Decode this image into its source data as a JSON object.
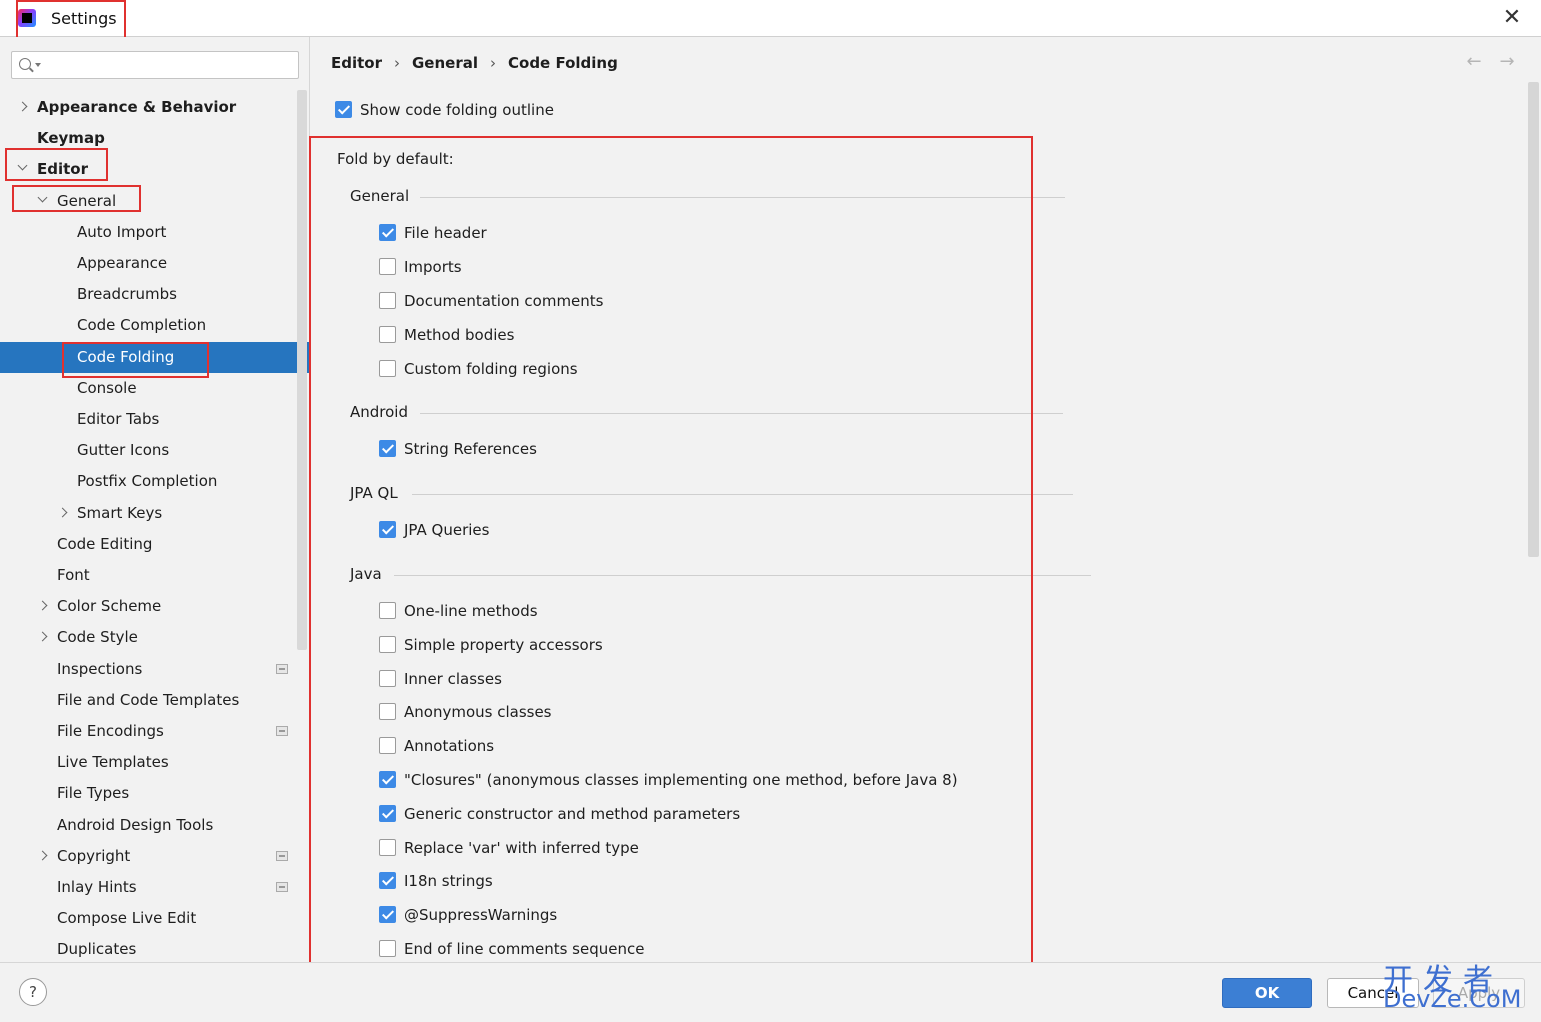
{
  "window": {
    "title": "Settings",
    "close_glyph": "✕",
    "help_glyph": "?"
  },
  "search": {
    "placeholder": ""
  },
  "breadcrumb": [
    "Editor",
    "General",
    "Code Folding"
  ],
  "breadcrumb_sep": "›",
  "nav": {
    "back": "←",
    "forward": "→"
  },
  "tree": [
    {
      "label": "Appearance & Behavior",
      "bold": true,
      "chevron": "right"
    },
    {
      "label": "Keymap",
      "bold": true,
      "chevron": ""
    },
    {
      "label": "Editor",
      "bold": true,
      "chevron": "down"
    },
    {
      "label": "General",
      "bold": false,
      "chevron": "down"
    },
    {
      "label": "Auto Import",
      "bold": false,
      "chevron": ""
    },
    {
      "label": "Appearance",
      "bold": false,
      "chevron": ""
    },
    {
      "label": "Breadcrumbs",
      "bold": false,
      "chevron": ""
    },
    {
      "label": "Code Completion",
      "bold": false,
      "chevron": ""
    },
    {
      "label": "Code Folding",
      "bold": false,
      "chevron": "",
      "selected": true
    },
    {
      "label": "Console",
      "bold": false,
      "chevron": ""
    },
    {
      "label": "Editor Tabs",
      "bold": false,
      "chevron": ""
    },
    {
      "label": "Gutter Icons",
      "bold": false,
      "chevron": ""
    },
    {
      "label": "Postfix Completion",
      "bold": false,
      "chevron": ""
    },
    {
      "label": "Smart Keys",
      "bold": false,
      "chevron": "right"
    },
    {
      "label": "Code Editing",
      "bold": false,
      "chevron": ""
    },
    {
      "label": "Font",
      "bold": false,
      "chevron": ""
    },
    {
      "label": "Color Scheme",
      "bold": false,
      "chevron": "right"
    },
    {
      "label": "Code Style",
      "bold": false,
      "chevron": "right"
    },
    {
      "label": "Inspections",
      "bold": false,
      "chevron": "",
      "project_icon": true
    },
    {
      "label": "File and Code Templates",
      "bold": false,
      "chevron": ""
    },
    {
      "label": "File Encodings",
      "bold": false,
      "chevron": "",
      "project_icon": true
    },
    {
      "label": "Live Templates",
      "bold": false,
      "chevron": ""
    },
    {
      "label": "File Types",
      "bold": false,
      "chevron": ""
    },
    {
      "label": "Android Design Tools",
      "bold": false,
      "chevron": ""
    },
    {
      "label": "Copyright",
      "bold": false,
      "chevron": "right",
      "project_icon": true
    },
    {
      "label": "Inlay Hints",
      "bold": false,
      "chevron": "",
      "project_icon": true
    },
    {
      "label": "Compose Live Edit",
      "bold": false,
      "chevron": ""
    },
    {
      "label": "Duplicates",
      "bold": false,
      "chevron": ""
    }
  ],
  "show_outline": {
    "label": "Show code folding outline",
    "checked": true
  },
  "fold_by_default": "Fold by default:",
  "groups": [
    {
      "title": "General",
      "items": [
        {
          "label": "File header",
          "checked": true
        },
        {
          "label": "Imports",
          "checked": false
        },
        {
          "label": "Documentation comments",
          "checked": false
        },
        {
          "label": "Method bodies",
          "checked": false
        },
        {
          "label": "Custom folding regions",
          "checked": false
        }
      ]
    },
    {
      "title": "Android",
      "items": [
        {
          "label": "String References",
          "checked": true
        }
      ]
    },
    {
      "title": "JPA QL",
      "items": [
        {
          "label": "JPA Queries",
          "checked": true
        }
      ]
    },
    {
      "title": "Java",
      "items": [
        {
          "label": "One-line methods",
          "checked": false
        },
        {
          "label": "Simple property accessors",
          "checked": false
        },
        {
          "label": "Inner classes",
          "checked": false
        },
        {
          "label": "Anonymous classes",
          "checked": false
        },
        {
          "label": "Annotations",
          "checked": false
        },
        {
          "label": "\"Closures\" (anonymous classes implementing one method, before Java 8)",
          "checked": true
        },
        {
          "label": "Generic constructor and method parameters",
          "checked": true
        },
        {
          "label": "Replace 'var' with inferred type",
          "checked": false
        },
        {
          "label": "I18n strings",
          "checked": true
        },
        {
          "label": "@SuppressWarnings",
          "checked": true
        },
        {
          "label": "End of line comments sequence",
          "checked": false
        }
      ]
    }
  ],
  "footer": {
    "ok": "OK",
    "cancel": "Cancel",
    "apply": "Apply"
  },
  "watermark": {
    "cn": "开发者",
    "en": "DevZe.CoM"
  },
  "colors": {
    "selection": "#2675bf",
    "checkbox_checked": "#3d8ae6",
    "highlight_box": "#e0312f",
    "ok_button": "#3c7fd4"
  }
}
